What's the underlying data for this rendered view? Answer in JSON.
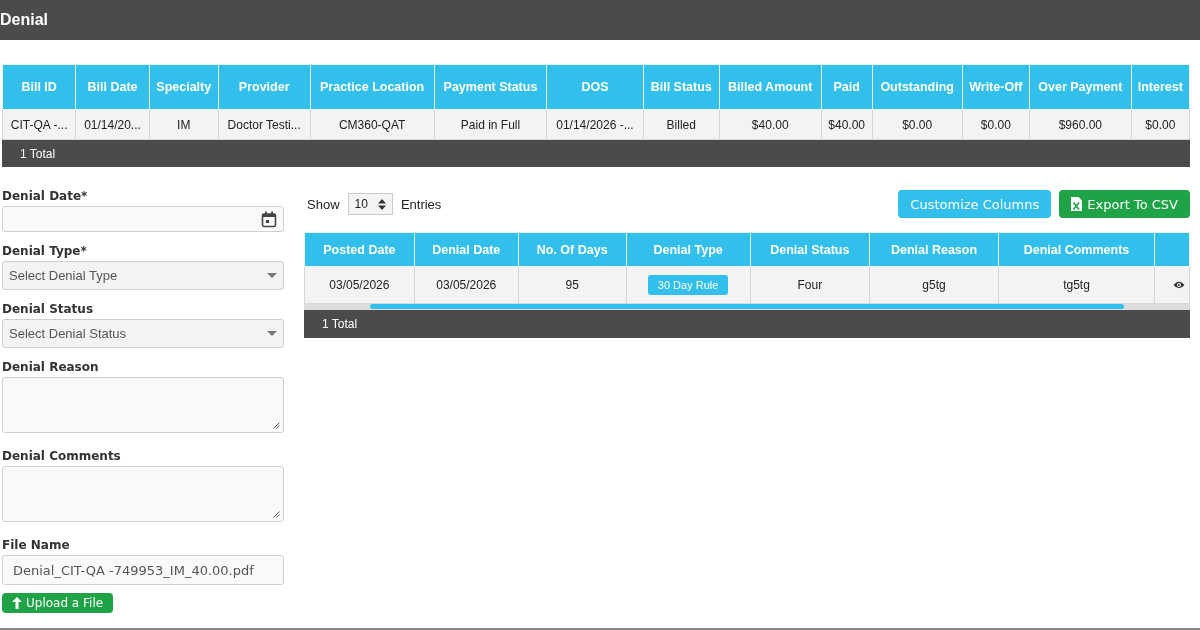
{
  "window": {
    "title": "Denial"
  },
  "bill_table": {
    "columns": [
      "Bill ID",
      "Bill Date",
      "Specialty",
      "Provider",
      "Practice Location",
      "Payment Status",
      "DOS",
      "Bill Status",
      "Billed Amount",
      "Paid",
      "Outstanding",
      "Write-Off",
      "Over Payment",
      "Interest"
    ],
    "rows": [
      [
        "CIT-QA -...",
        "01/14/20...",
        "IM",
        "Doctor Testi...",
        "CM360-QAT",
        "Paid in Full",
        "01/14/2026 -...",
        "Billed",
        "$40.00",
        "$40.00",
        "$0.00",
        "$0.00",
        "$960.00",
        "$0.00"
      ]
    ],
    "footer": "1 Total"
  },
  "denial_form": {
    "fields": [
      {
        "kind": "date",
        "label": "Denial Date*"
      },
      {
        "kind": "select",
        "label": "Denial Type*",
        "placeholder": "Select Denial Type"
      },
      {
        "kind": "select",
        "label": "Denial Status",
        "placeholder": "Select Denial Status"
      },
      {
        "kind": "textarea",
        "label": "Denial Reason"
      },
      {
        "kind": "textarea",
        "label": "Denial Comments"
      },
      {
        "kind": "text",
        "label": "File Name",
        "value": "Denial_CIT-QA -749953_IM_40.00.pdf"
      }
    ],
    "upload_button": "Upload a File"
  },
  "entries": {
    "show_label": "Show",
    "page_size": "10",
    "entries_label": "Entries"
  },
  "buttons": [
    {
      "kind": "customize",
      "label": "Customize Columns"
    },
    {
      "kind": "export",
      "label": "Export To CSV"
    }
  ],
  "denial_table": {
    "columns": [
      "Posted Date",
      "Denial Date",
      "No. Of Days",
      "Denial Type",
      "Denial Status",
      "Denial Reason",
      "Denial Comments"
    ],
    "rows": [
      {
        "cells": [
          {
            "kind": "text",
            "text": "03/05/2026"
          },
          {
            "kind": "text",
            "text": "03/05/2026"
          },
          {
            "kind": "text",
            "text": "95"
          },
          {
            "kind": "badge",
            "text": "30 Day Rule"
          },
          {
            "kind": "text",
            "text": "Four"
          },
          {
            "kind": "text",
            "text": "g5tg"
          },
          {
            "kind": "text",
            "text": "tg5tg"
          }
        ]
      }
    ],
    "footer": "1 Total"
  }
}
